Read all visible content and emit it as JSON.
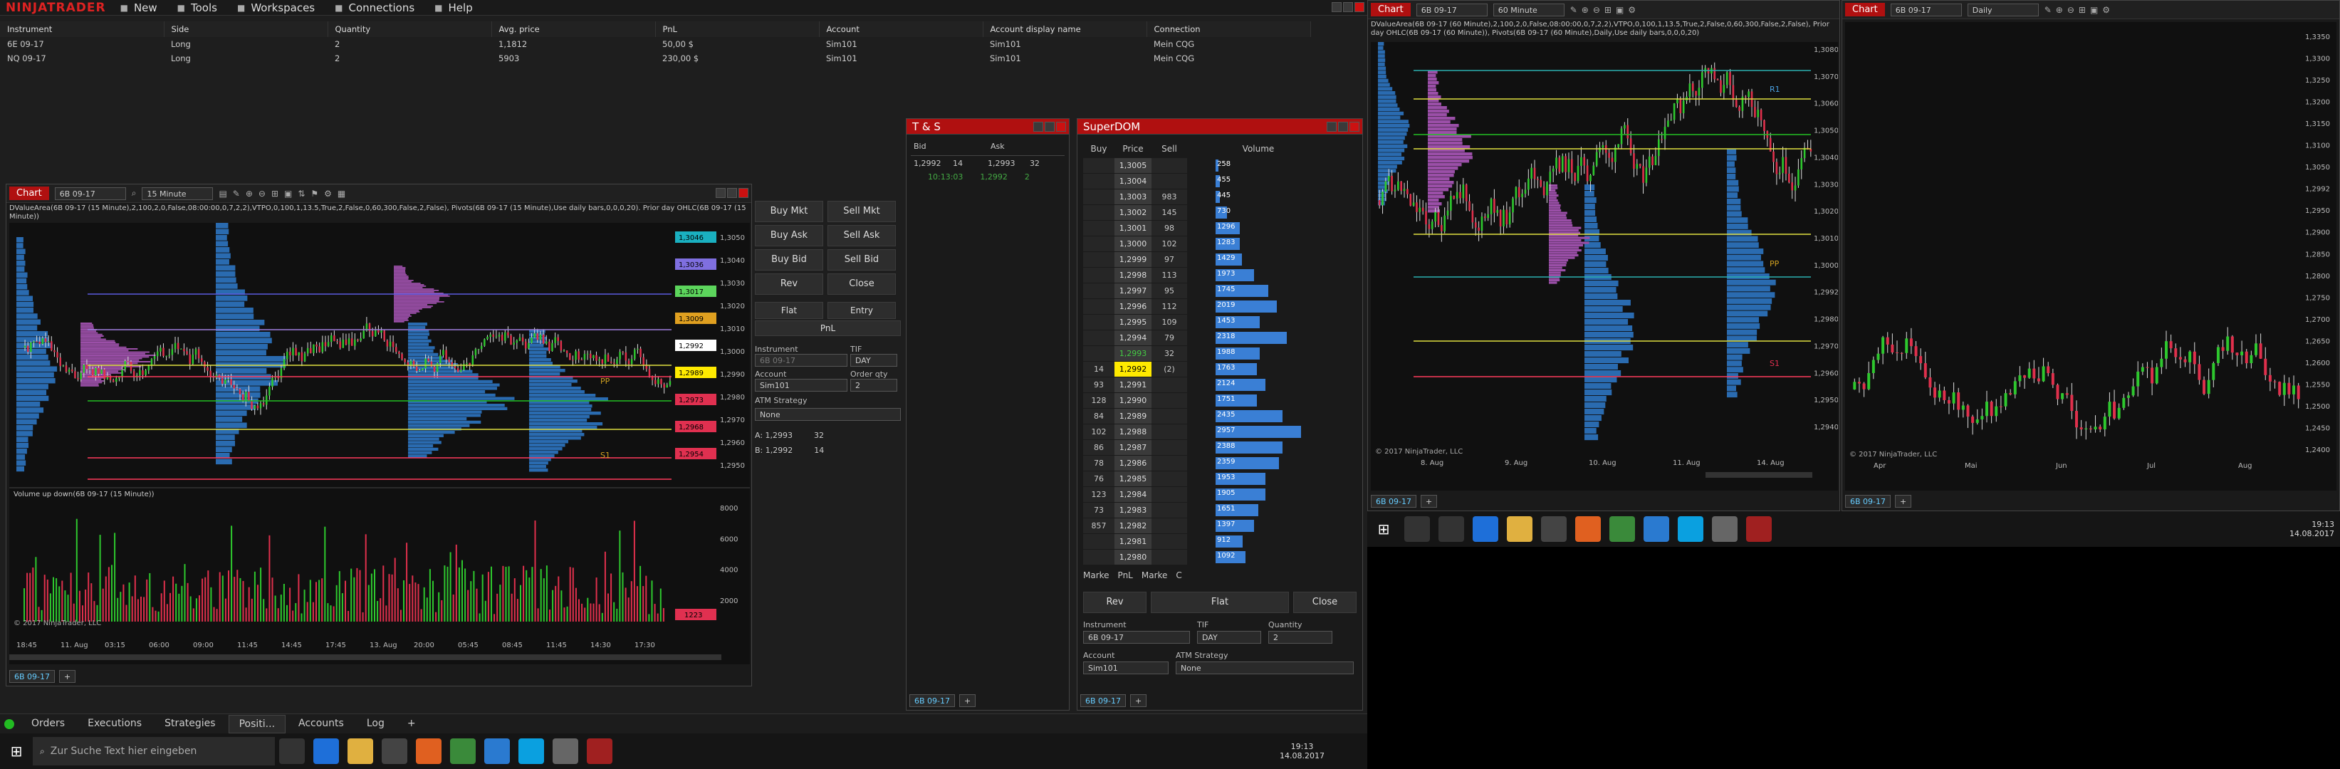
{
  "app": {
    "logo": "NINJATRADER",
    "menu": [
      {
        "label": "New",
        "icon": "plus-icon"
      },
      {
        "label": "Tools",
        "icon": "tools-icon"
      },
      {
        "label": "Workspaces",
        "icon": "folder-icon"
      },
      {
        "label": "Connections",
        "icon": "plug-icon"
      },
      {
        "label": "Help",
        "icon": "question-icon"
      }
    ]
  },
  "positions": {
    "headers": [
      "Instrument",
      "Side",
      "Quantity",
      "Avg. price",
      "PnL",
      "Account",
      "Account display name",
      "Connection"
    ],
    "rows": [
      [
        "6E 09-17",
        "Long",
        "2",
        "1,1812",
        "50,00 $",
        "Sim101",
        "Sim101",
        "Mein CQG"
      ],
      [
        "NQ 09-17",
        "Long",
        "2",
        "5903",
        "230,00 $",
        "Sim101",
        "Sim101",
        "Mein CQG"
      ]
    ]
  },
  "chart1": {
    "tag": "Chart",
    "instrument": "6B 09-17",
    "interval": "15 Minute",
    "info": "DValueArea(6B 09-17 (15 Minute),2,100,2,0,False,08:00:00,0,7,2,2),VTPO,0,100,1,13.5,True,2,False,0,60,300,False,2,False), Pivots(6B 09-17 (15 Minute),Use daily bars,0,0,0,20). Prior day OHLC(6B 09-17 (15 Minute))",
    "price_labels": [
      "1,3046",
      "1,3036",
      "1,3017",
      "1,3009",
      "1,2992",
      "1,2989",
      "1,2973",
      "1,2968",
      "1,2954"
    ],
    "axis_prices": [
      "1,3050",
      "1,3040",
      "1,3030",
      "1,3020",
      "1,3010",
      "1,3000",
      "1,2990",
      "1,2980",
      "1,2970",
      "1,2960",
      "1,2950"
    ],
    "time_labels": [
      "18:45",
      "11. Aug",
      "03:15",
      "06:00",
      "09:00",
      "11:45",
      "14:45",
      "17:45",
      "13. Aug",
      "20:00",
      "05:45",
      "08:45",
      "11:45",
      "14:30",
      "17:30"
    ],
    "pivot_labels": [
      "PP",
      "S1"
    ],
    "volume_title": "Volume up down(6B 09-17 (15 Minute))",
    "volume_axis": [
      "8000",
      "6000",
      "4000",
      "2000"
    ],
    "volume_tag": "1223",
    "copyright": "© 2017 NinjaTrader, LLC",
    "footer_tab": "6B 09-17"
  },
  "order_panel": {
    "buttons": [
      "Buy Mkt",
      "Sell Mkt",
      "Buy Ask",
      "Sell Ask",
      "Buy Bid",
      "Sell Bid",
      "Rev",
      "Close"
    ],
    "flat": "Flat",
    "entry": "Entry",
    "pnl": "PnL",
    "instrument_label": "Instrument",
    "instrument_value": "6B 09-17",
    "tif_label": "TIF",
    "tif_value": "DAY",
    "account_label": "Account",
    "account_value": "Sim101",
    "qty_label": "Order qty",
    "qty_value": "2",
    "atm_label": "ATM Strategy",
    "atm_value": "None",
    "ask_line": "A:  1,2993",
    "ask_size": "32",
    "bid_line": "B:  1,2992",
    "bid_size": "14"
  },
  "ts": {
    "title": "T & S",
    "headers": [
      "Bid",
      "Ask"
    ],
    "row": [
      "1,2992",
      "14",
      "1,2993",
      "32"
    ],
    "trade": [
      "10:13:03",
      "1,2992",
      "2"
    ],
    "footer_tab": "6B 09-17"
  },
  "superdom": {
    "title": "SuperDOM",
    "headers": [
      "Buy",
      "Price",
      "Sell",
      "Volume"
    ],
    "rows": [
      {
        "buy": "",
        "price": "1,3005",
        "sell": "",
        "vol": "258",
        "vp": 0.03
      },
      {
        "buy": "",
        "price": "1,3004",
        "sell": "",
        "vol": "455",
        "vp": 0.05
      },
      {
        "buy": "",
        "price": "1,3003",
        "sell": "983",
        "vol": "445",
        "vp": 0.05
      },
      {
        "buy": "",
        "price": "1,3002",
        "sell": "145",
        "vol": "730",
        "vp": 0.13
      },
      {
        "buy": "",
        "price": "1,3001",
        "sell": "98",
        "vol": "1296",
        "vp": 0.28
      },
      {
        "buy": "",
        "price": "1,3000",
        "sell": "102",
        "vol": "1283",
        "vp": 0.28
      },
      {
        "buy": "",
        "price": "1,2999",
        "sell": "97",
        "vol": "1429",
        "vp": 0.31
      },
      {
        "buy": "",
        "price": "1,2998",
        "sell": "113",
        "vol": "1973",
        "vp": 0.45
      },
      {
        "buy": "",
        "price": "1,2997",
        "sell": "95",
        "vol": "1745",
        "vp": 0.62
      },
      {
        "buy": "",
        "price": "1,2996",
        "sell": "112",
        "vol": "2019",
        "vp": 0.72
      },
      {
        "buy": "",
        "price": "1,2995",
        "sell": "109",
        "vol": "1453",
        "vp": 0.52
      },
      {
        "buy": "",
        "price": "1,2994",
        "sell": "79",
        "vol": "2318",
        "vp": 0.83
      },
      {
        "buy": "",
        "price": "1,2993",
        "sell": "32",
        "vol": "1988",
        "vp": 0.52
      },
      {
        "buy": "14",
        "price": "1,2992",
        "sell": "(2)",
        "vol": "1763",
        "vp": 0.48
      },
      {
        "buy": "93",
        "price": "1,2991",
        "sell": "",
        "vol": "2124",
        "vp": 0.58
      },
      {
        "buy": "128",
        "price": "1,2990",
        "sell": "",
        "vol": "1751",
        "vp": 0.48
      },
      {
        "buy": "84",
        "price": "1,2989",
        "sell": "",
        "vol": "2435",
        "vp": 0.78
      },
      {
        "buy": "102",
        "price": "1,2988",
        "sell": "",
        "vol": "2957",
        "vp": 1.0
      },
      {
        "buy": "86",
        "price": "1,2987",
        "sell": "",
        "vol": "2388",
        "vp": 0.78
      },
      {
        "buy": "78",
        "price": "1,2986",
        "sell": "",
        "vol": "2359",
        "vp": 0.74
      },
      {
        "buy": "76",
        "price": "1,2985",
        "sell": "",
        "vol": "1953",
        "vp": 0.58
      },
      {
        "buy": "123",
        "price": "1,2984",
        "sell": "",
        "vol": "1905",
        "vp": 0.58
      },
      {
        "buy": "73",
        "price": "1,2983",
        "sell": "",
        "vol": "1651",
        "vp": 0.5
      },
      {
        "buy": "857",
        "price": "1,2982",
        "sell": "",
        "vol": "1397",
        "vp": 0.45
      },
      {
        "buy": "",
        "price": "1,2981",
        "sell": "",
        "vol": "912",
        "vp": 0.32
      },
      {
        "buy": "",
        "price": "1,2980",
        "sell": "",
        "vol": "1092",
        "vp": 0.35
      }
    ],
    "footer": [
      "Marke",
      "PnL",
      "Marke",
      "C"
    ],
    "rev": "Rev",
    "flat": "Flat",
    "close": "Close",
    "instrument_label": "Instrument",
    "instrument_value": "6B 09-17",
    "tif_label": "TIF",
    "tif_value": "DAY",
    "qty_label": "Quantity",
    "qty_value": "2",
    "account_label": "Account",
    "account_value": "Sim101",
    "atm_label": "ATM Strategy",
    "atm_value": "None",
    "footer_tab": "6B 09-17"
  },
  "chart2": {
    "tag": "Chart",
    "instrument": "6B 09-17",
    "interval": "60 Minute",
    "info": "DValueArea(6B 09-17 (60 Minute),2,100,2,0,False,08:00:00,0,7,2,2),VTPO,0,100,1,13.5,True,2,False,0,60,300,False,2,False), Prior day OHLC(6B 09-17 (60 Minute)), Pivots(6B 09-17 (60 Minute),Daily,Use daily bars,0,0,0,20)",
    "axis_prices": [
      "1,3080",
      "1,3070",
      "1,3060",
      "1,3050",
      "1,3040",
      "1,3030",
      "1,3020",
      "1,3010",
      "1,3000",
      "1,2992",
      "1,2980",
      "1,2970",
      "1,2960",
      "1,2950",
      "1,2940"
    ],
    "time_labels": [
      "8. Aug",
      "9. Aug",
      "10. Aug",
      "11. Aug",
      "14. Aug"
    ],
    "pivot_labels": [
      "R1",
      "PP",
      "S1"
    ],
    "copyright": "© 2017 NinjaTrader, LLC",
    "footer_tab": "6B 09-17"
  },
  "chart3": {
    "tag": "Chart",
    "instrument": "6B 09-17",
    "interval": "Daily",
    "axis_prices": [
      "1,3350",
      "1,3300",
      "1,3250",
      "1,3200",
      "1,3150",
      "1,3100",
      "1,3050",
      "1,2992",
      "1,2950",
      "1,2900",
      "1,2850",
      "1,2800",
      "1,2750",
      "1,2700",
      "1,2650",
      "1,2600",
      "1,2550",
      "1,2500",
      "1,2450",
      "1,2400"
    ],
    "time_labels": [
      "Apr",
      "Mai",
      "Jun",
      "Jul",
      "Aug"
    ],
    "copyright": "© 2017 NinjaTrader, LLC",
    "footer_tab": "6B 09-17"
  },
  "bottom_tabs": [
    "Orders",
    "Executions",
    "Strategies",
    "Positi...",
    "Accounts",
    "Log"
  ],
  "taskbar": {
    "search_placeholder": "Zur Suche Text hier eingeben",
    "time": "19:13",
    "date": "14.08.2017"
  },
  "taskbar2": {
    "time": "19:13",
    "date": "14.08.2017"
  }
}
